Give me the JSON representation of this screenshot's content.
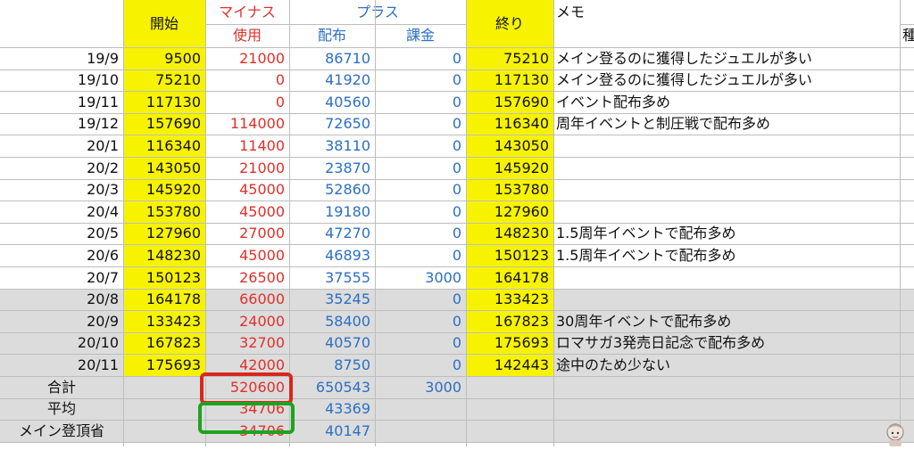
{
  "headers": {
    "start": "開始",
    "minus": "マイナス",
    "plus": "プラス",
    "end": "終り",
    "memo": "メモ",
    "partial": "種",
    "use": "使用",
    "dist": "配布",
    "charge": "課金"
  },
  "rows": [
    {
      "month": "19/9",
      "start": "9500",
      "use": "21000",
      "dist": "86710",
      "charge": "0",
      "end": "75210",
      "memo": "メイン登るのに獲得したジュエルが多い"
    },
    {
      "month": "19/10",
      "start": "75210",
      "use": "0",
      "dist": "41920",
      "charge": "0",
      "end": "117130",
      "memo": "メイン登るのに獲得したジュエルが多い"
    },
    {
      "month": "19/11",
      "start": "117130",
      "use": "0",
      "dist": "40560",
      "charge": "0",
      "end": "157690",
      "memo": "イベント配布多め"
    },
    {
      "month": "19/12",
      "start": "157690",
      "use": "114000",
      "dist": "72650",
      "charge": "0",
      "end": "116340",
      "memo": "周年イベントと制圧戦で配布多め"
    },
    {
      "month": "20/1",
      "start": "116340",
      "use": "11400",
      "dist": "38110",
      "charge": "0",
      "end": "143050",
      "memo": ""
    },
    {
      "month": "20/2",
      "start": "143050",
      "use": "21000",
      "dist": "23870",
      "charge": "0",
      "end": "145920",
      "memo": ""
    },
    {
      "month": "20/3",
      "start": "145920",
      "use": "45000",
      "dist": "52860",
      "charge": "0",
      "end": "153780",
      "memo": ""
    },
    {
      "month": "20/4",
      "start": "153780",
      "use": "45000",
      "dist": "19180",
      "charge": "0",
      "end": "127960",
      "memo": ""
    },
    {
      "month": "20/5",
      "start": "127960",
      "use": "27000",
      "dist": "47270",
      "charge": "0",
      "end": "148230",
      "memo": "1.5周年イベントで配布多め"
    },
    {
      "month": "20/6",
      "start": "148230",
      "use": "45000",
      "dist": "46893",
      "charge": "0",
      "end": "150123",
      "memo": "1.5周年イベントで配布多め"
    },
    {
      "month": "20/7",
      "start": "150123",
      "use": "26500",
      "dist": "37555",
      "charge": "3000",
      "end": "164178",
      "memo": ""
    },
    {
      "month": "20/8",
      "start": "164178",
      "use": "66000",
      "dist": "35245",
      "charge": "0",
      "end": "133423",
      "memo": ""
    },
    {
      "month": "20/9",
      "start": "133423",
      "use": "24000",
      "dist": "58400",
      "charge": "0",
      "end": "167823",
      "memo": "30周年イベントで配布多め"
    },
    {
      "month": "20/10",
      "start": "167823",
      "use": "32700",
      "dist": "40570",
      "charge": "0",
      "end": "175693",
      "memo": "ロマサガ3発売日記念で配布多め"
    },
    {
      "month": "20/11",
      "start": "175693",
      "use": "42000",
      "dist": "8750",
      "charge": "0",
      "end": "142443",
      "memo": "途中のため少ない"
    }
  ],
  "summary": [
    {
      "label": "合計",
      "use": "520600",
      "dist": "650543",
      "charge": "3000"
    },
    {
      "label": "平均",
      "use": "34706",
      "dist": "43369",
      "charge": ""
    },
    {
      "label": "メイン登頂省",
      "use": "34706",
      "dist": "40147",
      "charge": ""
    }
  ],
  "colors": {
    "highlight_yellow": "#f7f300",
    "minus_red": "#e0302a",
    "plus_blue": "#2b6fc4",
    "shaded_row": "#dcdcdc",
    "red_box": "#d8281e",
    "green_box": "#1fa31f"
  },
  "icons": {
    "avatar": "channel-avatar-icon"
  }
}
